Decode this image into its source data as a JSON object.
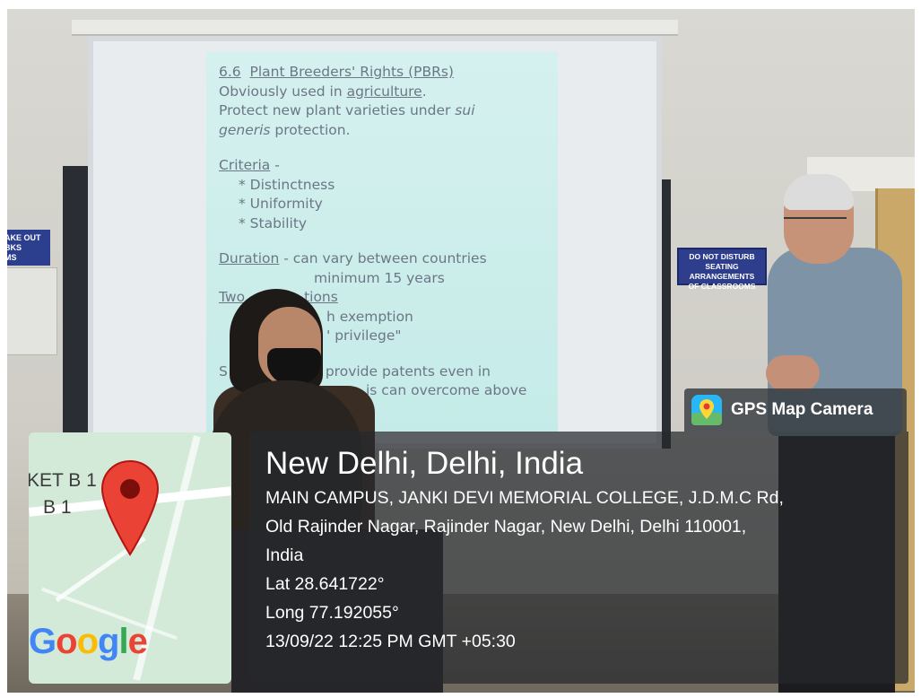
{
  "slide": {
    "heading_number": "6.6",
    "heading_title": "Plant Breeders' Rights (PBRs)",
    "line1_prefix": "Obviously used in ",
    "line1_link": "agriculture",
    "line1_suffix": ".",
    "line2": "Protect new plant varieties under ",
    "line2_italic": "sui",
    "line3_italic": "generis",
    "line3_suffix": " protection.",
    "criteria_label": "Criteria",
    "criteria_suffix": " -",
    "criteria_items": [
      "* Distinctness",
      "* Uniformity",
      "* Stability"
    ],
    "duration_label": "Duration",
    "duration_text": " - can vary between countries",
    "duration_min": "minimum 15 years",
    "two_label": "Two",
    "two_label_partial": "tions",
    "exemption": "h exemption",
    "privilege": "' privilege\"",
    "patents_prefix": "S",
    "patents_text": "s provide patents even in",
    "overcome": "is can overcome above"
  },
  "notice": {
    "line1": "DO NOT DISTURB",
    "line2": "SEATING ARRANGEMENTS",
    "line3": "OF CLASSROOMS"
  },
  "poster_left": {
    "line1": "AKE OUT",
    "line2": "BKS",
    "line3": "MS"
  },
  "map": {
    "label1": "KET B 1",
    "label2": "B 1",
    "google_g": "G",
    "google_o1": "o",
    "google_o2": "o",
    "google_g2": "g",
    "google_l": "l",
    "google_e": "e"
  },
  "gps": {
    "tag_label": "GPS Map Camera",
    "title": "New Delhi, Delhi, India",
    "address_line1": "MAIN CAMPUS, JANKI DEVI MEMORIAL COLLEGE, J.D.M.C Rd,",
    "address_line2": "Old Rajinder Nagar, Rajinder Nagar, New Delhi, Delhi 110001,",
    "address_line3": "India",
    "lat": "Lat 28.641722°",
    "long": "Long 77.192055°",
    "datetime": "13/09/22 12:25 PM GMT +05:30"
  },
  "icons": {
    "map_pin": "map-pin-icon",
    "gps_app": "gps-map-camera-icon"
  },
  "colors": {
    "slide_bg": "#cdeeeb",
    "slide_text": "#6c7686",
    "pin_red": "#ea4335",
    "overlay": "#26282c",
    "map_bg": "#d4ead9"
  }
}
